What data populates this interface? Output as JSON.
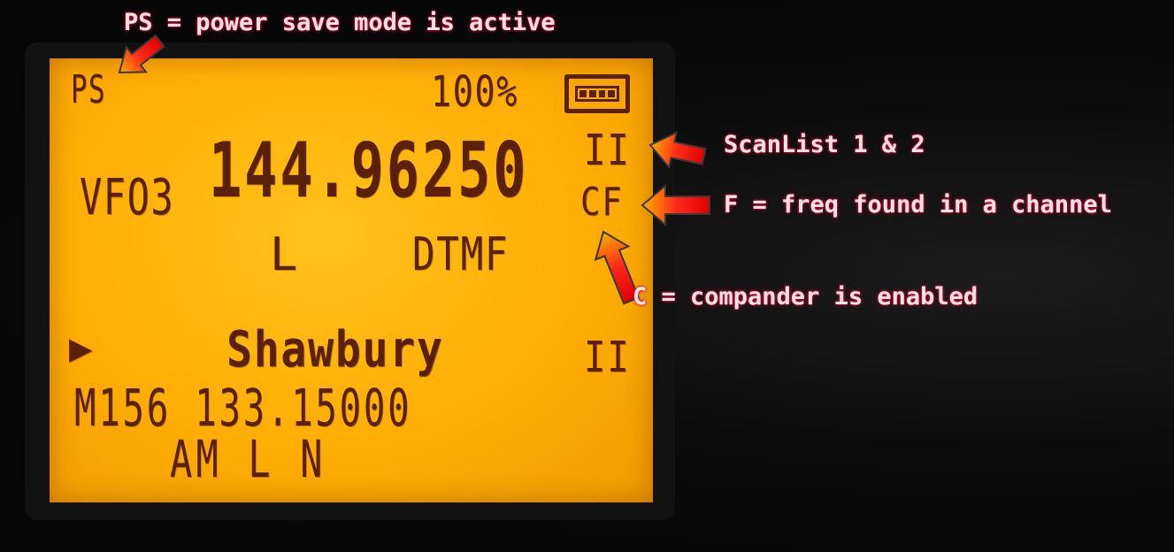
{
  "display": {
    "power_save": "PS",
    "battery_percent": "100%",
    "vfo_label": "VFO3",
    "frequency": "144.96250",
    "scanlist_indicator_top": "II",
    "flags": "CF",
    "power_level_top": "L",
    "dtmf": "DTMF",
    "channel_name": "Shawbury",
    "channel_line": "M156 133.15000",
    "modulation_line": "AM L N",
    "scanlist_indicator_bottom": "II",
    "active_marker": "▶"
  },
  "annotations": {
    "ps": "PS = power save mode is active",
    "scanlist": "ScanList 1 & 2",
    "freq_found": "F = freq found in a channel",
    "compander": "C = compander is enabled"
  },
  "colors": {
    "lcd_background": "#ffae05",
    "lcd_segments": "#5a2008",
    "annotation_text": "#ffe0e6",
    "arrow": "#ff1a1a"
  }
}
